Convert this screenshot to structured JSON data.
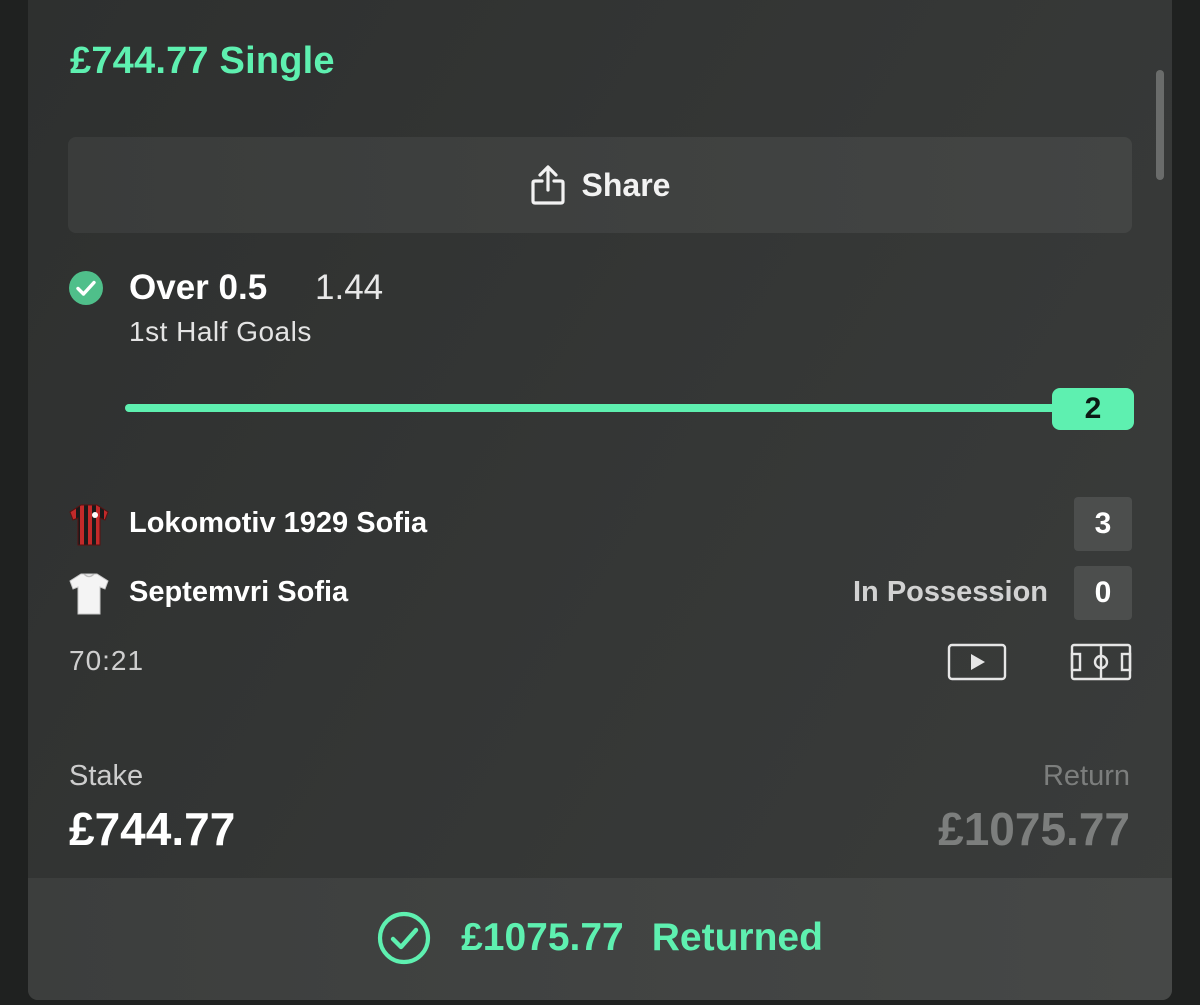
{
  "bet": {
    "title": "£744.77 Single",
    "share_label": "Share",
    "selection": {
      "name": "Over 0.5",
      "odds": "1.44",
      "market": "1st Half Goals",
      "progress_value": "2",
      "progress_fraction": 1.0
    },
    "match": {
      "home_team": "Lokomotiv 1929 Sofia",
      "home_score": "3",
      "away_team": "Septemvri Sofia",
      "away_status": "In Possession",
      "away_score": "0",
      "time": "70:21"
    },
    "stake_label": "Stake",
    "stake_value": "£744.77",
    "return_label": "Return",
    "return_value": "£1075.77",
    "returned_amount": "£1075.77",
    "returned_label": "Returned"
  },
  "icons": {
    "share": "share-icon",
    "selection_status": "check-circle-icon",
    "home_kit": "red-black-striped-shirt-icon",
    "away_kit": "white-shirt-icon",
    "video": "play-video-icon",
    "pitch": "pitch-view-icon",
    "returned_status": "check-circle-outline-icon"
  },
  "colors": {
    "accent": "#5ef0b0",
    "card_bg": "#333534",
    "muted_text": "#7c7e7d"
  }
}
